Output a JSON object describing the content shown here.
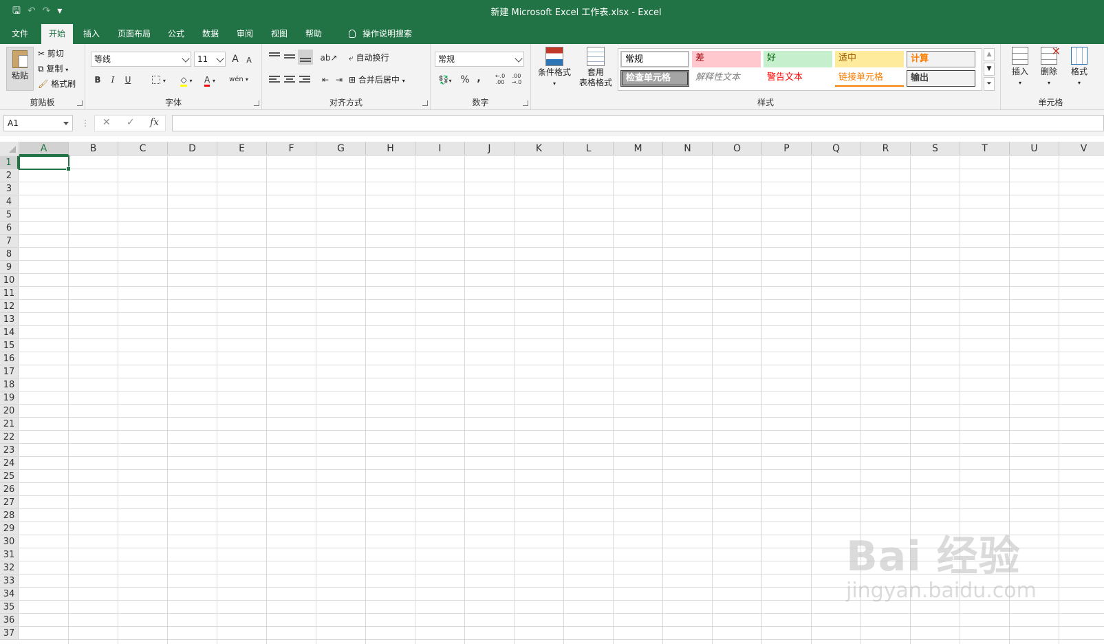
{
  "window": {
    "title": "新建 Microsoft Excel 工作表.xlsx  -  Excel"
  },
  "qat": {
    "save": "🖫",
    "undo": "↶",
    "redo": "↷",
    "customize": "▾"
  },
  "tabs": [
    "文件",
    "开始",
    "插入",
    "页面布局",
    "公式",
    "数据",
    "审阅",
    "视图",
    "帮助",
    "操作说明搜索"
  ],
  "active_tab": "开始",
  "ribbon": {
    "clipboard": {
      "label": "剪贴板",
      "paste": "粘贴",
      "cut": "剪切",
      "copy": "复制",
      "format_painter": "格式刷"
    },
    "font": {
      "label": "字体",
      "font_name": "等线",
      "font_size": "11",
      "bold": "B",
      "italic": "I",
      "underline": "U",
      "grow": "A",
      "shrink": "A",
      "phonetic": "wén"
    },
    "alignment": {
      "label": "对齐方式",
      "wrap_text": "自动换行",
      "merge_center": "合并后居中"
    },
    "number": {
      "label": "数字",
      "format": "常规",
      "percent": "%",
      "comma": ",",
      "inc_decimal": "←.0 .00",
      "dec_decimal": ".00 →.0"
    },
    "styles": {
      "label": "样式",
      "conditional": "条件格式",
      "format_table_1": "套用",
      "format_table_2": "表格格式",
      "cells": [
        {
          "text": "常规",
          "bg": "#ffffff",
          "fg": "#000000"
        },
        {
          "text": "差",
          "bg": "#ffc7ce",
          "fg": "#9c0006"
        },
        {
          "text": "好",
          "bg": "#c6efce",
          "fg": "#006100"
        },
        {
          "text": "适中",
          "bg": "#ffeb9c",
          "fg": "#9c5700"
        },
        {
          "text": "计算",
          "bg": "#f2f2f2",
          "fg": "#fa7d00"
        },
        {
          "text": "检查单元格",
          "bg": "#a5a5a5",
          "fg": "#ffffff"
        },
        {
          "text": "解释性文本",
          "bg": "#ffffff",
          "fg": "#7f7f7f"
        },
        {
          "text": "警告文本",
          "bg": "#ffffff",
          "fg": "#ff0000"
        },
        {
          "text": "链接单元格",
          "bg": "#ffffff",
          "fg": "#fa7d00"
        },
        {
          "text": "输出",
          "bg": "#f2f2f2",
          "fg": "#3f3f3f"
        }
      ]
    },
    "cells": {
      "label": "单元格",
      "insert": "插入",
      "delete": "删除",
      "format": "格式"
    }
  },
  "formula_bar": {
    "name_box": "A1",
    "cancel": "✕",
    "enter": "✓",
    "fx": "fx",
    "value": ""
  },
  "sheet": {
    "columns": [
      "A",
      "B",
      "C",
      "D",
      "E",
      "F",
      "G",
      "H",
      "I",
      "J",
      "K",
      "L",
      "M",
      "N",
      "O",
      "P",
      "Q",
      "R",
      "S",
      "T",
      "U",
      "V"
    ],
    "rows": [
      "1",
      "2",
      "3",
      "4",
      "5",
      "6",
      "7",
      "8",
      "9",
      "10",
      "11",
      "12",
      "13",
      "14",
      "15",
      "16",
      "17",
      "18",
      "19",
      "20",
      "21",
      "22",
      "23",
      "24",
      "25",
      "26",
      "27",
      "28",
      "29",
      "30",
      "31",
      "32",
      "33",
      "34",
      "35",
      "36",
      "37"
    ],
    "active_cell": "A1"
  },
  "watermark": {
    "line1": "Bai 经验",
    "line2": "jingyan.baidu.com"
  },
  "colors": {
    "brand": "#217346"
  }
}
